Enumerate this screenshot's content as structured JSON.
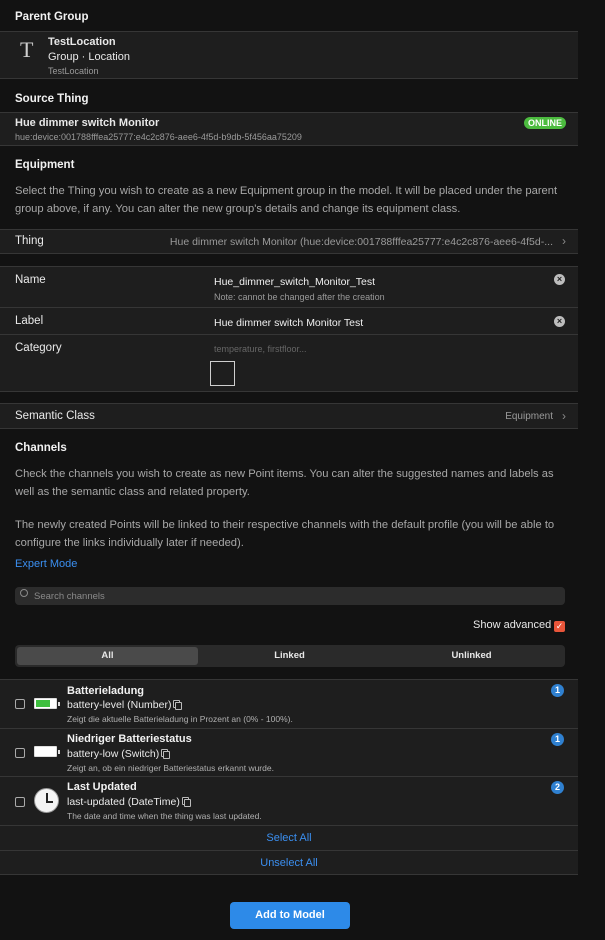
{
  "parent_group": {
    "section_title": "Parent Group",
    "icon_letter": "T",
    "name": "TestLocation",
    "type": "Group · Location",
    "sub": "TestLocation"
  },
  "source_thing": {
    "section_title": "Source Thing",
    "name": "Hue dimmer switch Monitor",
    "uid": "hue:device:001788fffea25777:e4c2c876-aee6-4f5d-b9db-5f456aa75209",
    "status": "ONLINE",
    "status_color": "#4cbb3f"
  },
  "equipment": {
    "section_title": "Equipment",
    "description": "Select the Thing you wish to create as a new Equipment group in the model. It will be placed under the parent group above, if any. You can alter the new group's details and change its equipment class.",
    "thing_label": "Thing",
    "thing_value": "Hue dimmer switch Monitor (hue:device:001788fffea25777:e4c2c876-aee6-4f5d-...",
    "name_label": "Name",
    "name_value": "Hue_dimmer_switch_Monitor_Test",
    "name_note": "Note: cannot be changed after the creation",
    "label_label": "Label",
    "label_value": "Hue dimmer switch Monitor Test",
    "category_label": "Category",
    "category_placeholder": "temperature, firstfloor...",
    "semantic_label": "Semantic Class",
    "semantic_value": "Equipment"
  },
  "channels": {
    "section_title": "Channels",
    "description1": "Check the channels you wish to create as new Point items. You can alter the suggested names and labels as well as the semantic class and related property.",
    "description2": "The newly created Points will be linked to their respective channels with the default profile (you will be able to configure the links individually later if needed).",
    "expert_mode": "Expert Mode",
    "search_placeholder": "Search channels",
    "show_advanced": "Show advanced",
    "show_advanced_checked": true,
    "tabs": [
      "All",
      "Linked",
      "Unlinked"
    ],
    "active_tab": "All",
    "items": [
      {
        "title": "Batterieladung",
        "id": "battery-level (Number)",
        "desc": "Zeigt die aktuelle Batterieladung in Prozent an (0% - 100%).",
        "badge": "1",
        "icon": "battery-full-icon"
      },
      {
        "title": "Niedriger Batteriestatus",
        "id": "battery-low (Switch)",
        "desc": "Zeigt an, ob ein niedriger Batteriestatus erkannt wurde.",
        "badge": "1",
        "icon": "battery-empty-icon"
      },
      {
        "title": "Last Updated",
        "id": "last-updated (DateTime)",
        "desc": "The date and time when the thing was last updated.",
        "badge": "2",
        "icon": "clock-icon"
      }
    ],
    "select_all": "Select All",
    "unselect_all": "Unselect All"
  },
  "add_button": "Add to Model",
  "colors": {
    "accent": "#3b8ff0",
    "button": "#2d8ae8",
    "checkbox_checked": "#e8553a"
  }
}
